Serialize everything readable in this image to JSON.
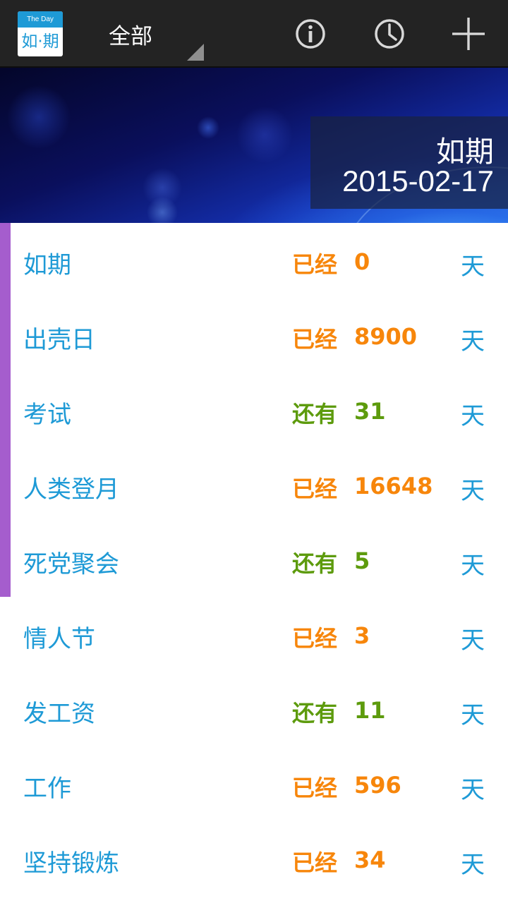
{
  "actionbar": {
    "logo_small": "The Day",
    "logo_main": "如·期",
    "filter_label": "全部",
    "icons": [
      "info-icon",
      "clock-icon",
      "plus-icon"
    ]
  },
  "banner": {
    "title": "如期",
    "date": "2015-02-17"
  },
  "colors": {
    "accent": "#1e9ad6",
    "past": "#f7860b",
    "future": "#5d9b0d",
    "pinned": "#a55dcd"
  },
  "events": [
    {
      "title": "如期",
      "status": "已经",
      "days": "0",
      "unit": "天",
      "kind": "past"
    },
    {
      "title": "出壳日",
      "status": "已经",
      "days": "8900",
      "unit": "天",
      "kind": "past"
    },
    {
      "title": "考试",
      "status": "还有",
      "days": "31",
      "unit": "天",
      "kind": "future"
    },
    {
      "title": "人类登月",
      "status": "已经",
      "days": "16648",
      "unit": "天",
      "kind": "past"
    },
    {
      "title": "死党聚会",
      "status": "还有",
      "days": "5",
      "unit": "天",
      "kind": "future"
    },
    {
      "title": "情人节",
      "status": "已经",
      "days": "3",
      "unit": "天",
      "kind": "past"
    },
    {
      "title": "发工资",
      "status": "还有",
      "days": "11",
      "unit": "天",
      "kind": "future"
    },
    {
      "title": "工作",
      "status": "已经",
      "days": "596",
      "unit": "天",
      "kind": "past"
    },
    {
      "title": "坚持锻炼",
      "status": "已经",
      "days": "34",
      "unit": "天",
      "kind": "past"
    }
  ]
}
